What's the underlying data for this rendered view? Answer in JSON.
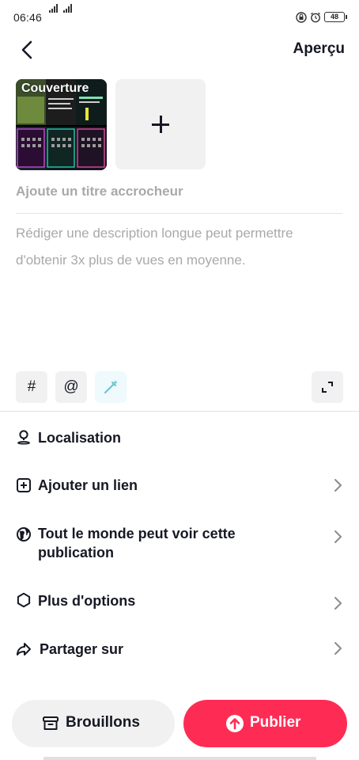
{
  "status_bar": {
    "time": "06:46",
    "battery": "48"
  },
  "header": {
    "preview_label": "Aperçu"
  },
  "media": {
    "cover_label": "Couverture"
  },
  "title": {
    "placeholder": "Ajoute un titre accrocheur"
  },
  "description": {
    "placeholder": "Rédiger une description longue peut permettre d'obtenir 3x plus de vues en moyenne."
  },
  "tools": {
    "hashtag": "#",
    "mention": "@"
  },
  "settings": [
    {
      "label": "Localisation"
    },
    {
      "label": "Ajouter un lien"
    },
    {
      "label": "Tout le monde peut voir cette publication"
    },
    {
      "label": "Plus d'options"
    },
    {
      "label": "Partager sur"
    }
  ],
  "bottom": {
    "drafts_label": "Brouillons",
    "publish_label": "Publier"
  },
  "colors": {
    "accent": "#fe2c55",
    "text": "#161823",
    "placeholder": "#a9a9ad",
    "surface": "#f1f1f2"
  }
}
